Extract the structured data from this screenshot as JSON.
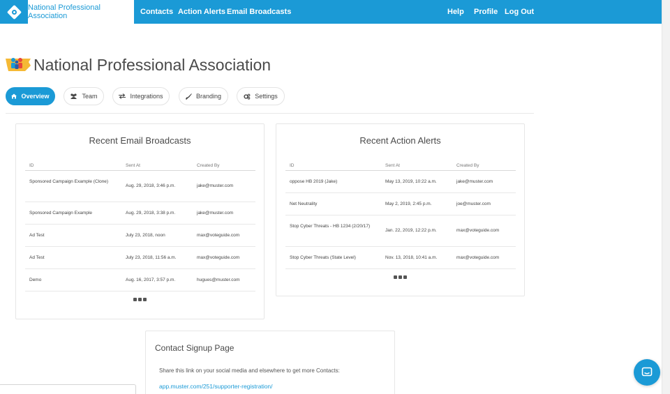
{
  "nav": {
    "active": "National Professional Association",
    "links": [
      "Contacts",
      "Action Alerts",
      "Email Broadcasts"
    ],
    "right_links": [
      "Help",
      "Profile",
      "Log Out"
    ]
  },
  "org": {
    "title": "National Professional Association"
  },
  "tabs": [
    "Overview",
    "Team",
    "Integrations",
    "Branding",
    "Settings"
  ],
  "email_broadcasts": {
    "title": "Recent Email Broadcasts",
    "columns": [
      "ID",
      "Sent At",
      "Created By"
    ],
    "rows": [
      [
        "Sponsored Campaign Example (Clone)",
        "Aug. 29, 2018, 3:46 p.m.",
        "jake@muster.com"
      ],
      [
        "Sponsored Campaign Example",
        "Aug. 29, 2018, 3:38 p.m.",
        "jake@muster.com"
      ],
      [
        "Ad Test",
        "July 23, 2018, noon",
        "max@voteguide.com"
      ],
      [
        "Ad Test",
        "July 23, 2018, 11:56 a.m.",
        "max@voteguide.com"
      ],
      [
        "Demo",
        "Aug. 16, 2017, 3:57 p.m.",
        "hugues@muster.com"
      ]
    ]
  },
  "action_alerts": {
    "title": "Recent Action Alerts",
    "columns": [
      "ID",
      "Sent At",
      "Created By"
    ],
    "rows": [
      [
        "oppose HB 2019 (Jake)",
        "May 13, 2019, 10:22 a.m.",
        "jake@muster.com"
      ],
      [
        "Net Neutrality",
        "May 2, 2019, 2:45 p.m.",
        "joe@muster.com"
      ],
      [
        "Stop Cyber Threats - HB 1234 (2/20/17)",
        "Jan. 22, 2019, 12:22 p.m.",
        "max@voteguide.com"
      ],
      [
        "Stop Cyber Threats (State Level)",
        "Nov. 13, 2018, 10:41 a.m.",
        "max@voteguide.com"
      ]
    ]
  },
  "signup": {
    "title": "Contact Signup Page",
    "text": "Share this link on your social media and elsewhere to get more Contacts:",
    "link": "app.muster.com/251/supporter-registration/"
  },
  "colors": {
    "brand": "#1b9ad6"
  },
  "icons": [
    "logo-icon",
    "home-icon",
    "team-icon",
    "integrations-icon",
    "branding-icon",
    "settings-icon",
    "more-icon",
    "chat-icon"
  ]
}
